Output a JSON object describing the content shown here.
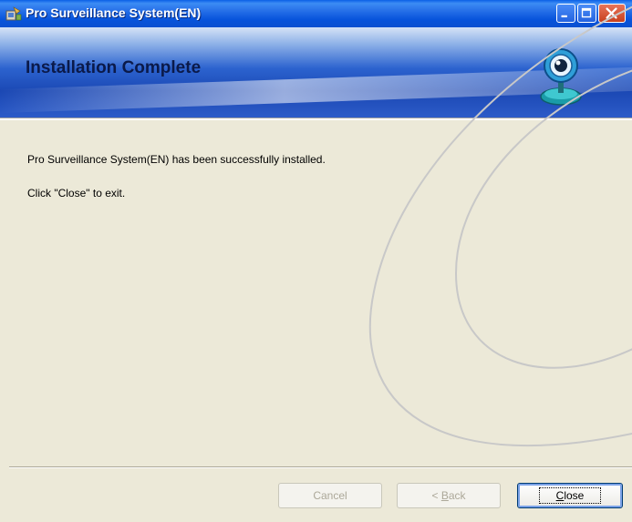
{
  "window": {
    "title": "Pro Surveillance System(EN)",
    "controls": [
      "minimize",
      "maximize",
      "close"
    ]
  },
  "banner": {
    "title": "Installation Complete",
    "icon": "webcam-icon"
  },
  "content": {
    "message_1": "Pro Surveillance System(EN) has been successfully installed.",
    "message_2": "Click \"Close\" to exit."
  },
  "buttons": {
    "cancel": "Cancel",
    "back_prefix": "< ",
    "back_mnemonic": "B",
    "back_rest": "ack",
    "close_mnemonic": "C",
    "close_rest": "lose"
  },
  "colors": {
    "titlebar": "#0a5fe6",
    "dialog_bg": "#ece9d8",
    "disabled_text": "#aca899"
  }
}
